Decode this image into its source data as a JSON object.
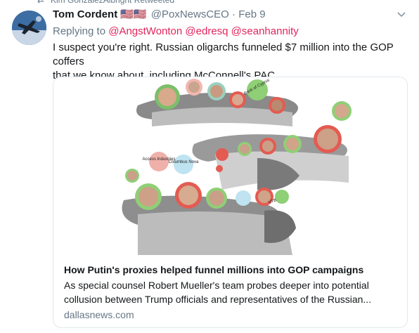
{
  "retweet": {
    "text": "Kim GonzalezAlbright Retweeted"
  },
  "tweet": {
    "author_name": "Tom Cordent",
    "flags": "🇺🇸🇺🇸",
    "handle": "@PoxNewsCEO",
    "separator": "·",
    "time": "Feb 9",
    "reply_prefix": "Replying to",
    "reply_mentions": [
      "@AngstWonton",
      "@edresq",
      "@seanhannity"
    ],
    "text_line1": "I suspect you're right. Russian oligarchs funneled $7 million into the GOP coffers",
    "text_line2": "that we know about, including McConnell's PAC."
  },
  "card": {
    "image_labels": [
      "Bank of Cyprus",
      "Columbus Nova",
      "Access Industries",
      "VTB"
    ],
    "title": "How Putin's proxies helped funnel millions into GOP campaigns",
    "description_line1": "As special counsel Robert Mueller's team probes deeper into potential",
    "description_line2": "collusion between Trump officials and representatives of the Russian...",
    "domain": "dallasnews.com"
  },
  "colors": {
    "reply_mention": "#e0245e",
    "secondary_text": "#657786",
    "card_border": "#e1e8ed"
  },
  "icons": [
    "retweet-icon",
    "chevron-down-icon",
    "avatar-image"
  ]
}
